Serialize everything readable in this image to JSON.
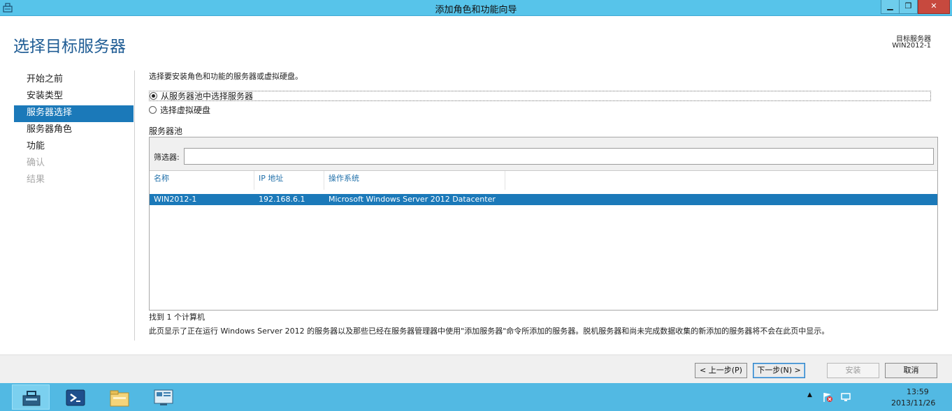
{
  "window": {
    "title": "添加角色和功能向导",
    "minimize": "▁",
    "maximize": "❐",
    "close": "✕"
  },
  "header": {
    "page_title": "选择目标服务器",
    "destination_label": "目标服务器",
    "destination_value": "WIN2012-1"
  },
  "nav": {
    "items": [
      {
        "label": "开始之前",
        "state": "normal"
      },
      {
        "label": "安装类型",
        "state": "normal"
      },
      {
        "label": "服务器选择",
        "state": "active"
      },
      {
        "label": "服务器角色",
        "state": "normal"
      },
      {
        "label": "功能",
        "state": "normal"
      },
      {
        "label": "确认",
        "state": "disabled"
      },
      {
        "label": "结果",
        "state": "disabled"
      }
    ]
  },
  "main": {
    "instruction": "选择要安装角色和功能的服务器或虚拟硬盘。",
    "options": [
      {
        "label": "从服务器池中选择服务器",
        "checked": true
      },
      {
        "label": "选择虚拟硬盘",
        "checked": false
      }
    ],
    "pool_title": "服务器池",
    "filter_label": "筛选器:",
    "filter_value": "",
    "columns": [
      "名称",
      "IP 地址",
      "操作系统"
    ],
    "rows": [
      {
        "name": "WIN2012-1",
        "ip": "192.168.6.1",
        "os": "Microsoft Windows Server 2012 Datacenter"
      }
    ],
    "found_text": "找到 1 个计算机",
    "note": "此页显示了正在运行 Windows Server 2012 的服务器以及那些已经在服务器管理器中使用\"添加服务器\"命令所添加的服务器。脱机服务器和尚未完成数据收集的新添加的服务器将不会在此页中显示。"
  },
  "footer": {
    "prev": "< 上一步(P)",
    "next": "下一步(N) >",
    "install": "安装",
    "cancel": "取消"
  },
  "taskbar": {
    "items": [
      "server-manager-icon",
      "powershell-icon",
      "file-explorer-icon",
      "control-panel-icon"
    ],
    "tray_chevron": "▲",
    "clock_time": "13:59",
    "clock_date": "2013/11/26"
  },
  "colors": {
    "titlebar": "#57c4ea",
    "accent": "#1b79b9",
    "title_text": "#1f5c94",
    "taskbar": "#52b9e3"
  }
}
